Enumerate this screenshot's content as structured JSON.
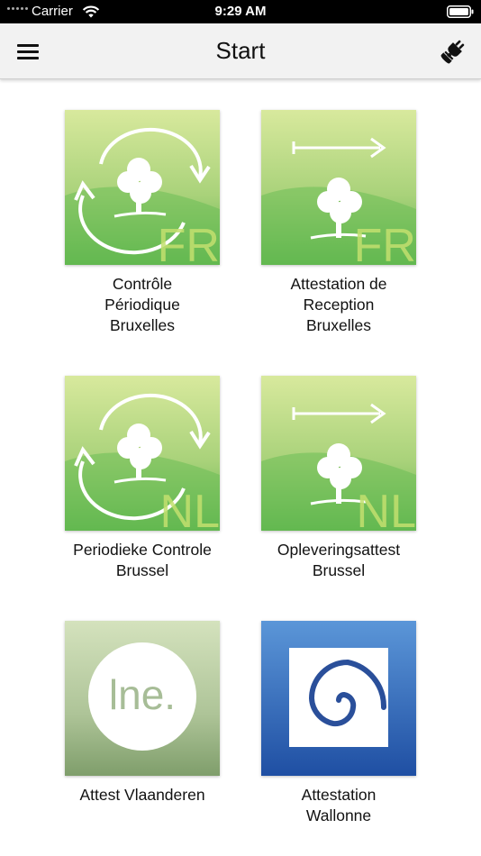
{
  "status_bar": {
    "carrier": "Carrier",
    "time": "9:29 AM"
  },
  "nav": {
    "title": "Start",
    "menu_icon": "hamburger-menu-icon",
    "right_icon": "plug-icon"
  },
  "tiles": [
    {
      "id": "cp-bxl-fr",
      "lines": [
        "Contrôle",
        "Périodique",
        "Bruxelles"
      ],
      "badge": "FR",
      "icon": "tree-cycle-arrows-icon"
    },
    {
      "id": "ar-bxl-fr",
      "lines": [
        "Attestation de",
        "Reception",
        "Bruxelles"
      ],
      "badge": "FR",
      "icon": "tree-arrow-right-icon"
    },
    {
      "id": "pc-bxl-nl",
      "lines": [
        "Periodieke Controle",
        "Brussel"
      ],
      "badge": "NL",
      "icon": "tree-cycle-arrows-icon"
    },
    {
      "id": "oa-bxl-nl",
      "lines": [
        "Opleveringsattest",
        "Brussel"
      ],
      "badge": "NL",
      "icon": "tree-arrow-right-icon"
    },
    {
      "id": "att-vla",
      "lines": [
        "Attest Vlaanderen"
      ],
      "logo_text": "lne.",
      "icon": "lne-logo-icon"
    },
    {
      "id": "att-wal",
      "lines": [
        "Attestation",
        "Wallonne"
      ],
      "icon": "wallonia-spiral-logo-icon"
    }
  ],
  "colors": {
    "green_light": "#d6e89a",
    "green_dark": "#5bb34a",
    "wallonie_blue": "#2a62b6",
    "lne_green": "#8fae7a"
  }
}
